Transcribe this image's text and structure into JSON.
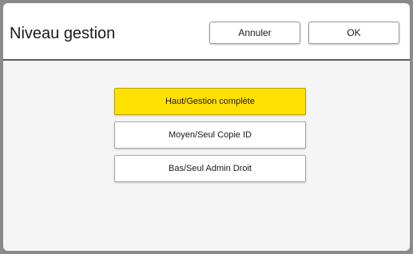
{
  "dialog": {
    "title": "Niveau gestion",
    "cancel_label": "Annuler",
    "ok_label": "OK"
  },
  "options": [
    {
      "label": "Haut/Gestion complète",
      "selected": true
    },
    {
      "label": "Moyen/Seul Copie ID",
      "selected": false
    },
    {
      "label": "Bas/Seul Admin Droit",
      "selected": false
    }
  ],
  "colors": {
    "selected_fill": "#ffe000",
    "frame": "#8a8a8a",
    "divider": "#5a5a5a"
  }
}
